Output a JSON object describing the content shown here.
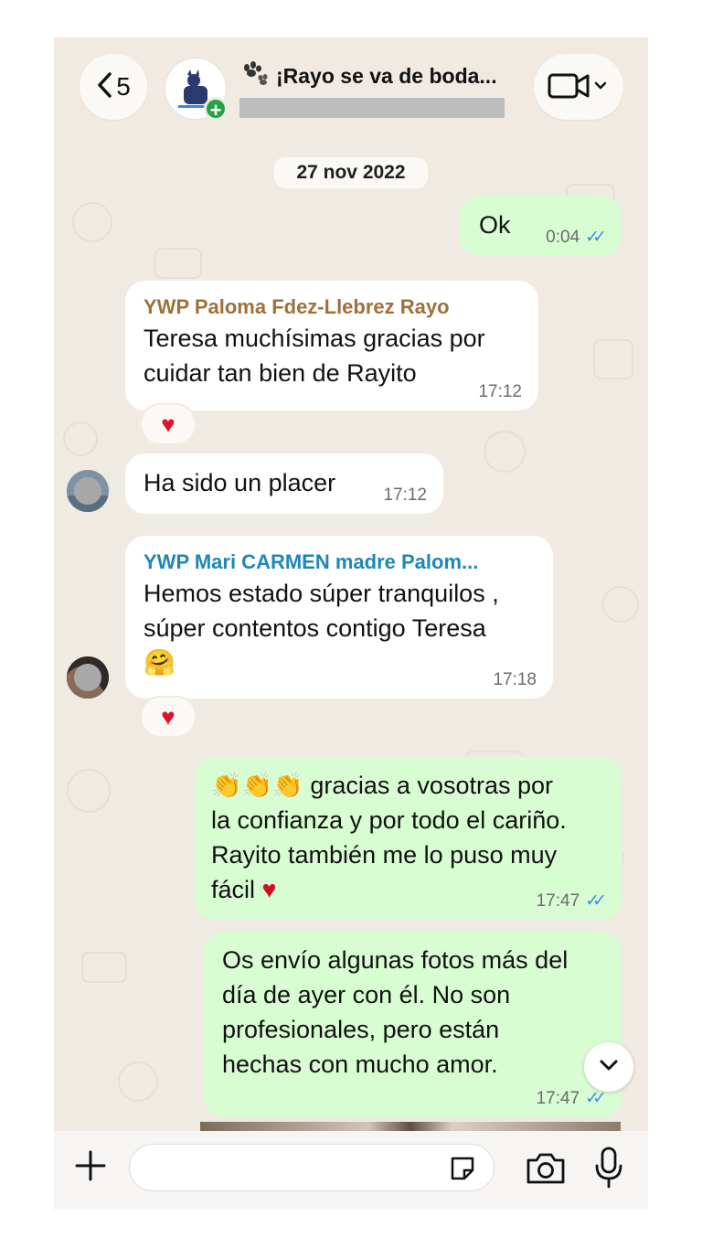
{
  "header": {
    "back_count": "5",
    "group_title": "¡Rayo se va de boda...",
    "avatar_badge": "+"
  },
  "date_chip": "27 nov 2022",
  "messages": [
    {
      "direction": "out",
      "text": "Ok",
      "time": "0:04",
      "status": "read"
    },
    {
      "direction": "in",
      "sender": "YWP Paloma Fdez-Llebrez Rayo",
      "sender_color": "#a0703a",
      "lines": [
        "Teresa muchísimas gracias por",
        "cuidar tan bien de Rayito"
      ],
      "time": "17:12",
      "reaction": "♥"
    },
    {
      "direction": "in",
      "text": "Ha sido un placer",
      "time": "17:12"
    },
    {
      "direction": "in",
      "sender": "YWP Mari CARMEN madre Palom...",
      "sender_color": "#1f87b8",
      "lines": [
        "Hemos estado súper tranquilos ,",
        "súper contentos contigo Teresa"
      ],
      "emoji": "🤗",
      "time": "17:18",
      "reaction": "♥"
    },
    {
      "direction": "out",
      "lines": [
        "gracias a vosotras por",
        "la confianza y por todo el cariño.",
        "Rayito también me lo puso muy",
        "fácil"
      ],
      "time": "17:47",
      "status": "read"
    },
    {
      "direction": "out",
      "lines": [
        "Os envío algunas fotos más del",
        "día de ayer con él. No son",
        "profesionales, pero están",
        "hechas con mucho amor."
      ],
      "time": "17:47",
      "status": "read"
    }
  ],
  "icons": {
    "back": "chevron-left-icon",
    "video": "video-camera-icon",
    "scroll": "chevron-down-icon",
    "plus": "plus-icon",
    "sticker": "sticker-icon",
    "camera": "camera-icon",
    "mic": "microphone-icon"
  },
  "colors": {
    "wallpaper": "#efeae2",
    "outgoing_bubble": "#d9fdd3",
    "incoming_bubble": "#ffffff",
    "read_ticks": "#3b8ee8",
    "add_badge": "#25a244"
  }
}
